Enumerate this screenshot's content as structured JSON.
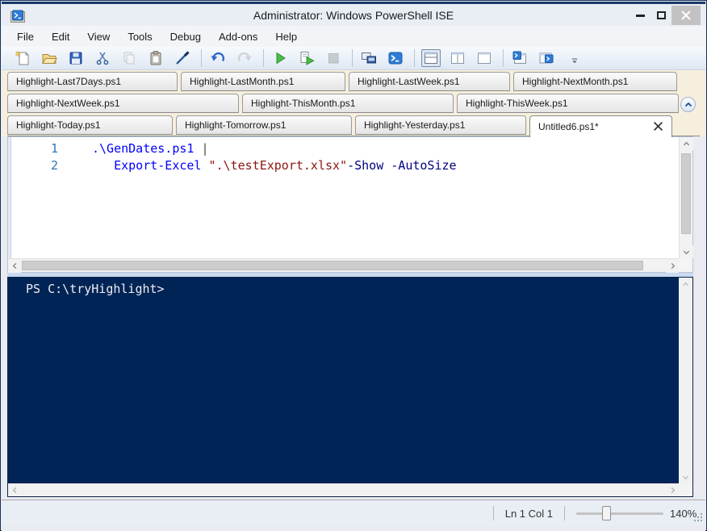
{
  "window": {
    "title": "Administrator: Windows PowerShell ISE"
  },
  "menu": {
    "items": [
      "File",
      "Edit",
      "View",
      "Tools",
      "Debug",
      "Add-ons",
      "Help"
    ]
  },
  "toolbar": {
    "groups": [
      [
        "new-script-icon",
        "open-script-icon",
        "save-icon",
        "cut-icon",
        "copy-icon",
        "paste-icon",
        "clear-console-icon"
      ],
      [
        "undo-icon",
        "redo-icon"
      ],
      [
        "run-script-icon",
        "run-selection-icon",
        "stop-operation-icon"
      ],
      [
        "new-remote-powershell-tab-icon",
        "start-powershell-icon"
      ],
      [
        "show-script-pane-top-icon",
        "show-script-pane-right-icon",
        "show-script-pane-maximized-icon"
      ],
      [
        "new-powershell-tab-icon",
        "show-command-window-icon"
      ]
    ],
    "disabled": [
      "copy-icon",
      "redo-icon",
      "stop-operation-icon"
    ],
    "selected": [
      "show-script-pane-top-icon"
    ],
    "overflow": "toolbar-overflow-icon"
  },
  "tab_rows": [
    [
      {
        "label": "Highlight-Last7Days.ps1"
      },
      {
        "label": "Highlight-LastMonth.ps1"
      },
      {
        "label": "Highlight-LastWeek.ps1"
      },
      {
        "label": "Highlight-NextMonth.ps1"
      }
    ],
    [
      {
        "label": "Highlight-NextWeek.ps1"
      },
      {
        "label": "Highlight-ThisMonth.ps1"
      },
      {
        "label": "Highlight-ThisWeek.ps1"
      }
    ],
    [
      {
        "label": "Highlight-Today.ps1"
      },
      {
        "label": "Highlight-Tomorrow.ps1"
      },
      {
        "label": "Highlight-Yesterday.ps1"
      },
      {
        "label": "Untitled6.ps1*",
        "active": true
      }
    ]
  ],
  "editor": {
    "lines": [
      {
        "num": "1",
        "segs": [
          [
            "cmdlet",
            ".\\GenDates.ps1"
          ],
          [
            "plain",
            " "
          ],
          [
            "operator",
            "|"
          ]
        ]
      },
      {
        "num": "2",
        "segs": [
          [
            "plain",
            "   "
          ],
          [
            "cmdlet",
            "Export-Excel"
          ],
          [
            "plain",
            " "
          ],
          [
            "string",
            "\".\\testExport.xlsx\""
          ],
          [
            "param",
            "-Show"
          ],
          [
            "plain",
            " "
          ],
          [
            "param",
            "-AutoSize"
          ]
        ]
      }
    ]
  },
  "console": {
    "prompt": "PS C:\\tryHighlight>"
  },
  "statusbar": {
    "position": "Ln 1 Col 1",
    "zoom": "140%"
  },
  "colors": {
    "console_bg": "#012456",
    "cmdlet": "#0000FF",
    "string": "#8B1513",
    "param": "#000080",
    "operator": "#4A4A4A",
    "line_number": "#2E75B6",
    "title_border": "#1B3A6B"
  }
}
